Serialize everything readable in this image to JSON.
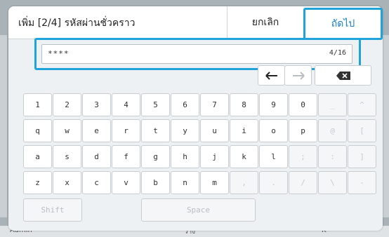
{
  "background": {
    "left_label": "Admin",
    "center_label": "ว่าง",
    "ink_label": "K"
  },
  "header": {
    "title": "เพิ่ม [2/4] รหัสผ่านชั่วคราว",
    "cancel_label": "ยกเลิก",
    "next_label": "ถัดไป"
  },
  "password": {
    "masked_value": "****",
    "char_count": "4/16"
  },
  "keyboard": {
    "rows": [
      [
        "1",
        "2",
        "3",
        "4",
        "5",
        "6",
        "7",
        "8",
        "9",
        "0",
        "_",
        "^"
      ],
      [
        "q",
        "w",
        "e",
        "r",
        "t",
        "y",
        "u",
        "i",
        "o",
        "p",
        "@",
        "["
      ],
      [
        "a",
        "s",
        "d",
        "f",
        "g",
        "h",
        "j",
        "k",
        "l",
        ";",
        ":",
        "]"
      ],
      [
        "z",
        "x",
        "c",
        "v",
        "b",
        "n",
        "m",
        ",",
        ".",
        "/",
        "\\",
        "-"
      ]
    ],
    "shift_label": "Shift",
    "space_label": "Space"
  },
  "colors": {
    "accent": "#1fa3db",
    "link": "#1a7fd0"
  },
  "icons": {
    "left": "arrow-left-icon",
    "right": "arrow-right-icon",
    "backspace": "backspace-icon"
  }
}
